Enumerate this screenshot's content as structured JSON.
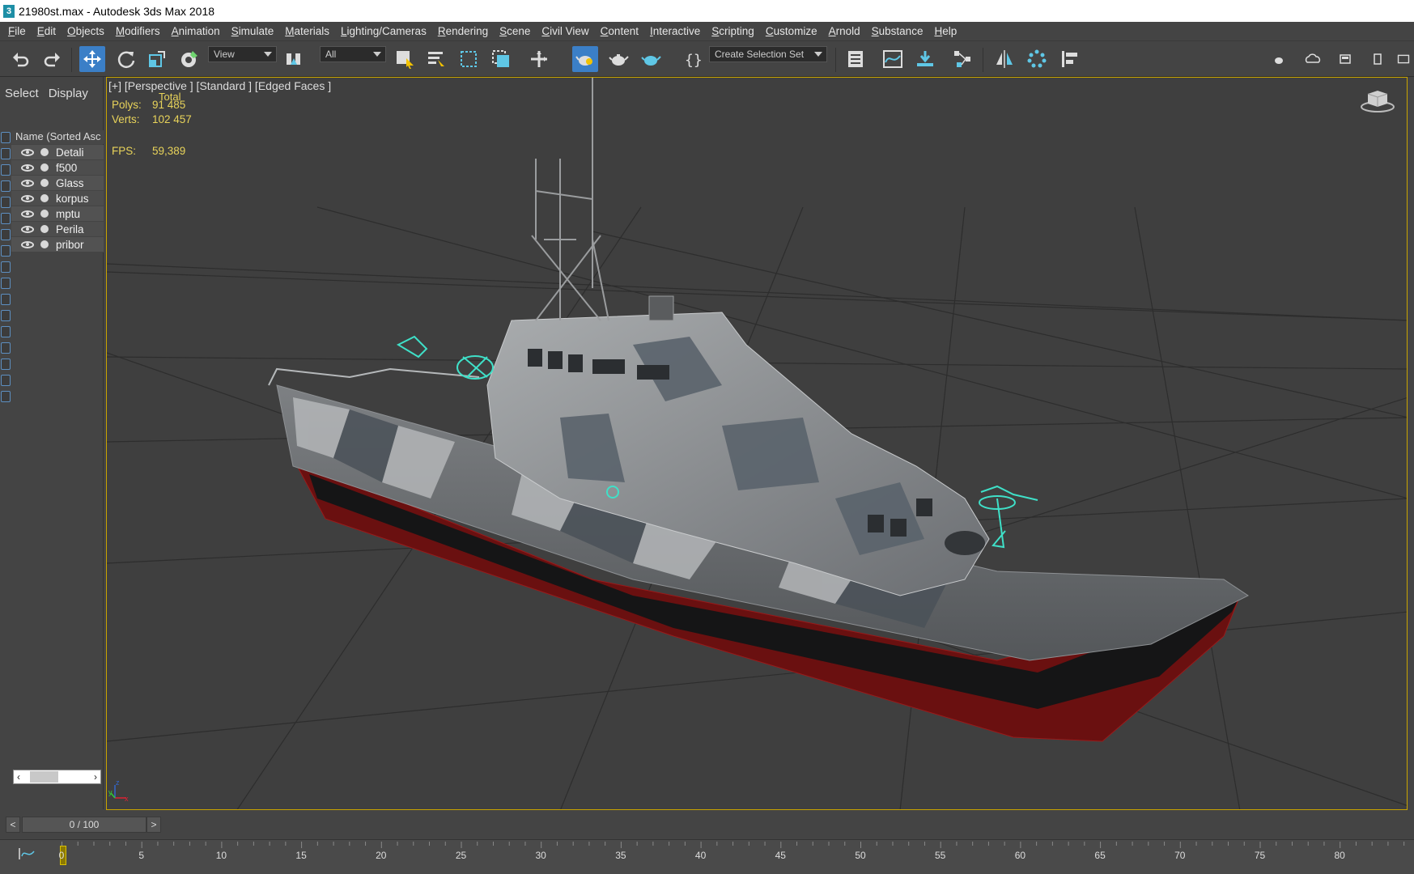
{
  "window": {
    "title": "21980st.max - Autodesk 3ds Max 2018",
    "app_icon": "3"
  },
  "menu": [
    "File",
    "Edit",
    "Objects",
    "Modifiers",
    "Animation",
    "Simulate",
    "Materials",
    "Lighting/Cameras",
    "Rendering",
    "Scene",
    "Civil View",
    "Content",
    "Interactive",
    "Scripting",
    "Customize",
    "Arnold",
    "Substance",
    "Help"
  ],
  "toolbar": {
    "coord_dropdown": "View",
    "filter_dropdown": "All",
    "selection_set": "Create Selection Set",
    "accent_color": "#3b7fc7"
  },
  "explorer": {
    "tabs": [
      "Select",
      "Display"
    ],
    "column_header": "Name (Sorted Asc",
    "objects": [
      "Detali",
      "f500",
      "Glass",
      "korpus",
      "mptu",
      "Perila",
      "pribor"
    ]
  },
  "viewport": {
    "label": "[+] [Perspective ] [Standard ] [Edged Faces ]",
    "stats": {
      "total_label": "Total",
      "polys_label": "Polys:",
      "polys": "91 485",
      "verts_label": "Verts:",
      "verts": "102 457",
      "fps_label": "FPS:",
      "fps": "59,389"
    },
    "axis": {
      "x": "x",
      "y": "y",
      "z": "z"
    }
  },
  "timeline": {
    "slider_text": "0 / 100",
    "prev": "<",
    "next": ">",
    "ticks": [
      "0",
      "5",
      "10",
      "15",
      "20",
      "25",
      "30",
      "35",
      "40",
      "45",
      "50",
      "55",
      "60",
      "65",
      "70",
      "75",
      "80"
    ]
  }
}
